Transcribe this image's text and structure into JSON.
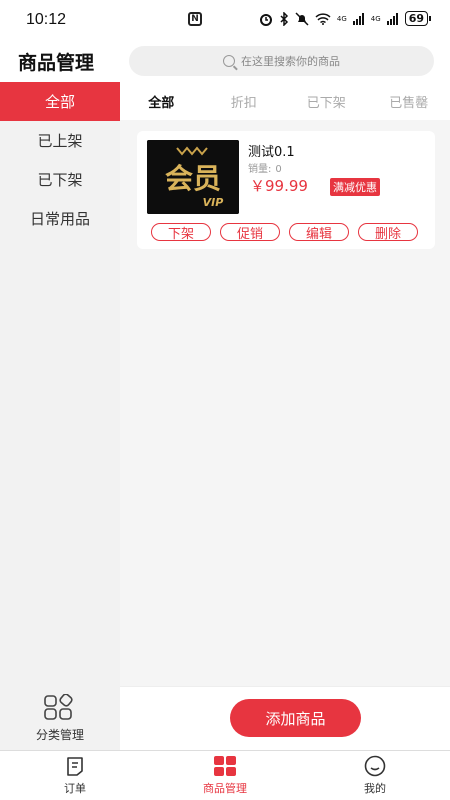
{
  "status_bar": {
    "time": "10:12",
    "battery": "69",
    "signal_1": "4G",
    "signal_2": "4G"
  },
  "header": {
    "title": "商品管理",
    "search_placeholder": "在这里搜索你的商品"
  },
  "sidebar": {
    "items": [
      {
        "label": "全部",
        "active": true
      },
      {
        "label": "已上架",
        "active": false
      },
      {
        "label": "已下架",
        "active": false
      },
      {
        "label": "日常用品",
        "active": false
      }
    ],
    "category_management_label": "分类管理"
  },
  "tabs": [
    {
      "label": "全部",
      "active": true
    },
    {
      "label": "折扣",
      "active": false
    },
    {
      "label": "已下架",
      "active": false
    },
    {
      "label": "已售罄",
      "active": false
    }
  ],
  "product": {
    "name": "测试0.1",
    "sales_label": "销量:",
    "sales_value": "0",
    "price": "￥99.99",
    "badge": "满减优惠",
    "image_logo_text": "会员",
    "image_vip_text": "VIP",
    "actions": [
      "下架",
      "促销",
      "编辑",
      "删除"
    ]
  },
  "add_button_label": "添加商品",
  "bottom_nav": [
    {
      "label": "订单",
      "icon": "order-icon",
      "active": false
    },
    {
      "label": "商品管理",
      "icon": "grid-icon",
      "active": true
    },
    {
      "label": "我的",
      "icon": "profile-icon",
      "active": false
    }
  ],
  "colors": {
    "accent": "#e73540",
    "sidebar_bg": "#f2f2f2",
    "main_bg": "#f5f5f5"
  }
}
